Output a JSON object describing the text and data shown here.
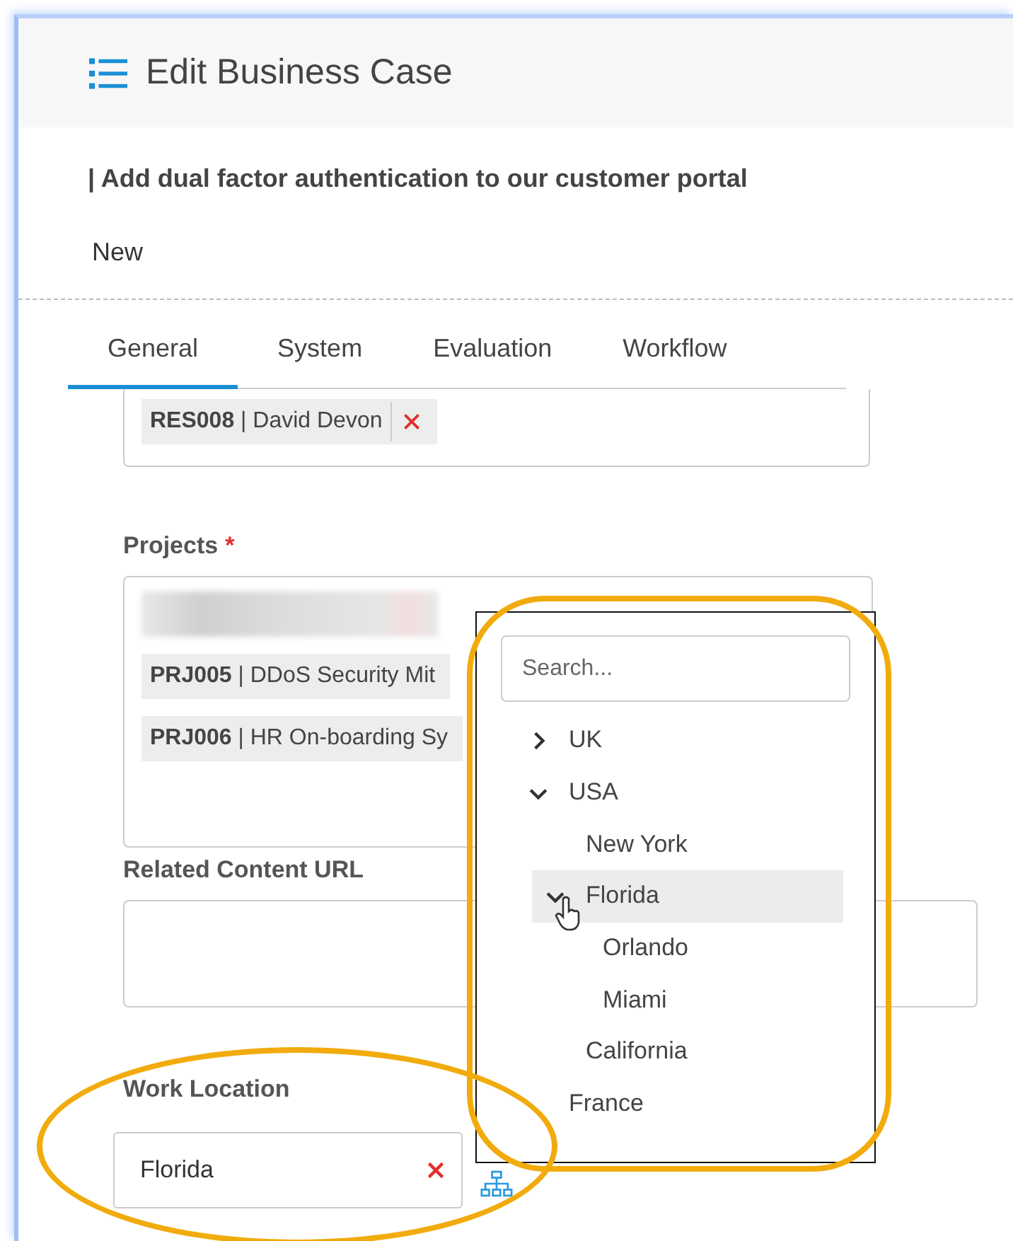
{
  "window": {
    "title": "Edit Business Case"
  },
  "record": {
    "title": "| Add dual factor authentication to our customer portal",
    "status": "New"
  },
  "tabs": [
    {
      "label": "General",
      "selected": true
    },
    {
      "label": "System",
      "selected": false
    },
    {
      "label": "Evaluation",
      "selected": false
    },
    {
      "label": "Workflow",
      "selected": false
    }
  ],
  "resources": {
    "chips": [
      {
        "text": "**RES008** | David Devon",
        "removable": true
      }
    ]
  },
  "projects": {
    "label": "Projects",
    "required_mark": "*",
    "chips": [
      {
        "kind": "blurred"
      },
      {
        "kind": "text",
        "text": "**PRJ005** | DDoS Security Mit"
      },
      {
        "kind": "text",
        "text": "**PRJ006** | HR On-boarding Sy"
      }
    ]
  },
  "related_url": {
    "label": "Related Content URL"
  },
  "work_location": {
    "label": "Work Location",
    "value": "Florida"
  },
  "dropdown": {
    "search_placeholder": "Search...",
    "tree": [
      {
        "label": "UK",
        "expanded": false,
        "selected": false
      },
      {
        "label": "USA",
        "expanded": true,
        "selected": false,
        "children": [
          {
            "label": "New York",
            "selected": false
          },
          {
            "label": "Florida",
            "expanded": true,
            "selected": true,
            "children": [
              {
                "label": "Orlando",
                "selected": false
              },
              {
                "label": "Miami",
                "selected": false
              }
            ]
          },
          {
            "label": "California",
            "selected": false
          }
        ]
      },
      {
        "label": "France",
        "selected": false
      }
    ]
  }
}
